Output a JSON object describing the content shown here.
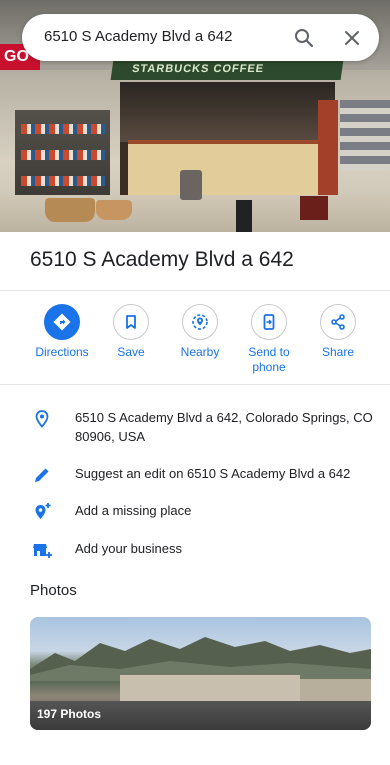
{
  "search": {
    "query": "6510 S Academy Blvd a 642"
  },
  "hero": {
    "sign_text": "GO",
    "banner_text": "STARBUCKS COFFEE"
  },
  "place": {
    "title": "6510 S Academy Blvd a 642"
  },
  "actions": [
    {
      "label": "Directions",
      "icon": "directions-icon"
    },
    {
      "label": "Save",
      "icon": "bookmark-icon"
    },
    {
      "label": "Nearby",
      "icon": "nearby-icon"
    },
    {
      "label": "Send to phone",
      "icon": "send-to-phone-icon"
    },
    {
      "label": "Share",
      "icon": "share-icon"
    }
  ],
  "info": {
    "address": "6510 S Academy Blvd a 642, Colorado Springs, CO 80906, USA",
    "suggest_edit": "Suggest an edit on 6510 S Academy Blvd a 642",
    "add_missing": "Add a missing place",
    "add_business": "Add your business"
  },
  "photos": {
    "heading": "Photos",
    "count_label": "197 Photos"
  },
  "colors": {
    "accent": "#1a73e8",
    "text": "#202124",
    "divider": "#e3e3e3"
  }
}
